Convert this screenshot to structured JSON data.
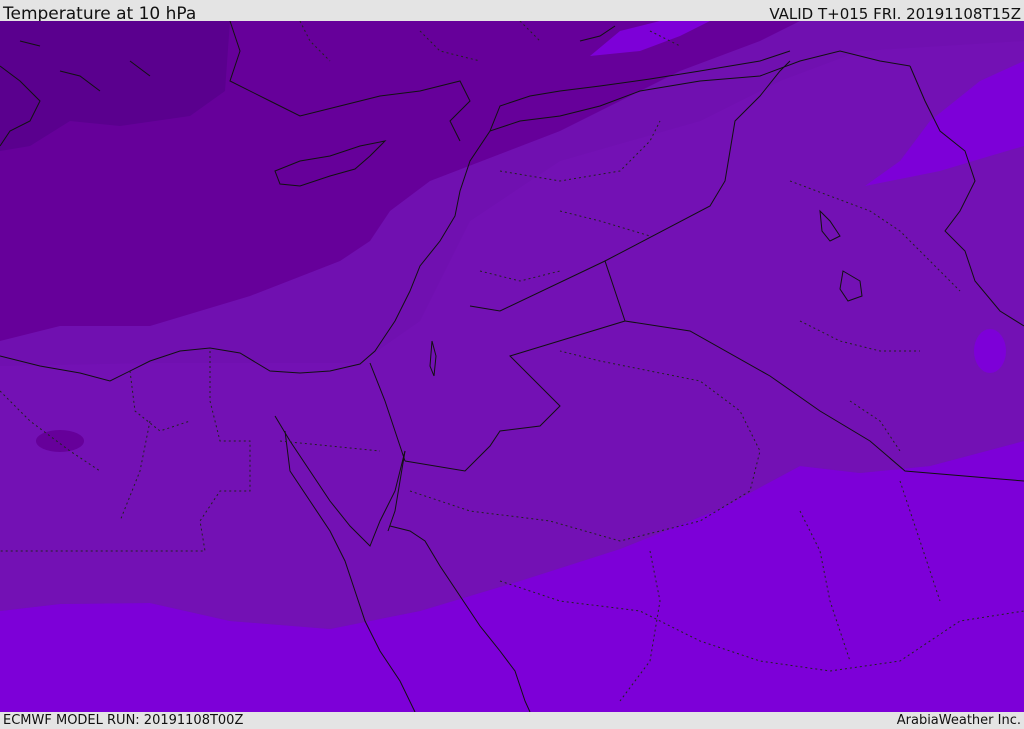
{
  "header": {
    "title": "Temperature at 10 hPa",
    "valid": "VALID T+015 FRI. 20191108T15Z"
  },
  "footer": {
    "model_run": "ECMWF MODEL RUN: 20191108T00Z",
    "credit": "ArabiaWeather Inc."
  },
  "colors": {
    "band_coldest": "#5a008e",
    "band_cold": "#66009a",
    "band_mid": "#7010b0",
    "band_mid2": "#7612b8",
    "band_warm": "#7d00d8",
    "background": "#e4e4e4"
  }
}
